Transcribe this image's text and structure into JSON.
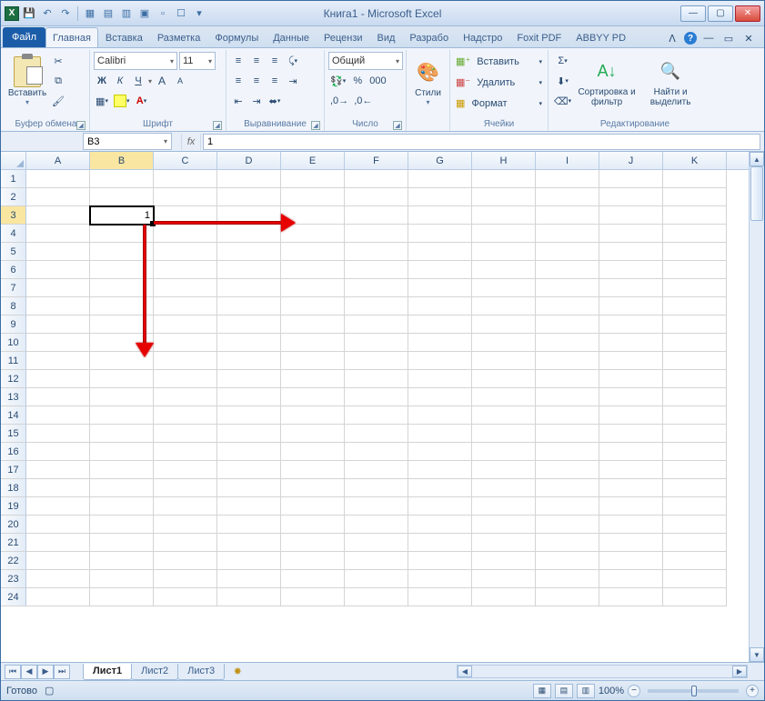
{
  "title": "Книга1 - Microsoft Excel",
  "qat_icons": [
    "save",
    "undo",
    "redo",
    "sep",
    "qat5",
    "qat6",
    "qat7",
    "qat8",
    "qat9",
    "qat10",
    "qat11",
    "dd"
  ],
  "ribbon": {
    "file_label": "Файл",
    "tabs": [
      "Главная",
      "Вставка",
      "Разметка",
      "Формулы",
      "Данные",
      "Рецензи",
      "Вид",
      "Разрабо",
      "Надстро",
      "Foxit PDF",
      "ABBYY PD"
    ],
    "active_index": 0,
    "groups": {
      "clipboard": {
        "paste": "Вставить",
        "label": "Буфер обмена"
      },
      "font": {
        "font_name": "Calibri",
        "font_size": "11",
        "label": "Шрифт",
        "buttons": {
          "bold": "Ж",
          "italic": "К",
          "underline": "Ч"
        }
      },
      "alignment": {
        "label": "Выравнивание"
      },
      "number": {
        "format": "Общий",
        "label": "Число"
      },
      "styles": {
        "styles_btn": "Стили",
        "label": ""
      },
      "cells": {
        "insert": "Вставить",
        "delete": "Удалить",
        "format": "Формат",
        "label": "Ячейки"
      },
      "editing": {
        "sort": "Сортировка и фильтр",
        "find": "Найти и выделить",
        "label": "Редактирование"
      }
    }
  },
  "formula_bar": {
    "name_box": "B3",
    "fx": "fx",
    "formula": "1"
  },
  "grid": {
    "columns": [
      "A",
      "B",
      "C",
      "D",
      "E",
      "F",
      "G",
      "H",
      "I",
      "J",
      "K"
    ],
    "rows": 24,
    "selected_col": "B",
    "selected_row": 3,
    "active_cell_value": "1"
  },
  "sheets": {
    "tabs": [
      "Лист1",
      "Лист2",
      "Лист3"
    ],
    "active": 0
  },
  "status": {
    "ready": "Готово",
    "zoom": "100%"
  }
}
